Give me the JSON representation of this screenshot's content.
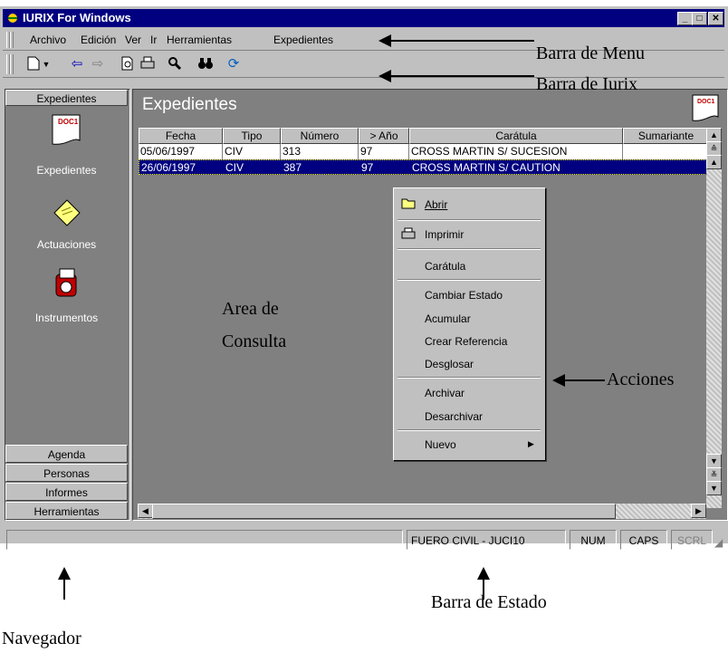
{
  "window": {
    "title": "IURIX For Windows",
    "min_label": "_",
    "max_label": "□",
    "close_label": "✕"
  },
  "menu": {
    "items": [
      "Archivo",
      "Edición",
      "Ver",
      "Ir",
      "Herramientas",
      "Expedientes"
    ]
  },
  "toolbar": {
    "icons": [
      "new-document-icon",
      "dropdown-icon",
      "back-icon",
      "forward-icon",
      "print-preview-icon",
      "print-icon",
      "search-icon",
      "binoculars-icon",
      "refresh-icon"
    ]
  },
  "navigator": {
    "header": "Expedientes",
    "items": [
      {
        "label": "Expedientes",
        "icon": "document-icon",
        "icon_text": "DOC1"
      },
      {
        "label": "Actuaciones",
        "icon": "notepad-icon"
      },
      {
        "label": "Instrumentos",
        "icon": "instruments-icon"
      }
    ],
    "bottom_buttons": [
      "Agenda",
      "Personas",
      "Informes",
      "Herramientas"
    ]
  },
  "main": {
    "title": "Expedientes",
    "doc_icon_text": "DOC1",
    "columns": [
      "Fecha",
      "Tipo",
      "Número",
      "> Año",
      "Carátula",
      "Sumariante"
    ],
    "rows": [
      {
        "fecha": "05/06/1997",
        "tipo": "CIV",
        "numero": "313",
        "anio": "97",
        "caratula": "CROSS MARTIN S/ SUCESION",
        "sumariante": ""
      },
      {
        "fecha": "26/06/1997",
        "tipo": "CIV",
        "numero": "387",
        "anio": "97",
        "caratula": "CROSS MARTIN S/ CAUTION",
        "sumariante": ""
      }
    ],
    "selected_row": 1
  },
  "context_menu": {
    "items": [
      "Abrir",
      "Imprimir",
      "Carátula",
      "Cambiar Estado",
      "Acumular",
      "Crear Referencia",
      "Desglosar",
      "Archivar",
      "Desarchivar",
      "Nuevo"
    ],
    "submenu_arrow": "▶"
  },
  "status_bar": {
    "court": "FUERO CIVIL - JUCI10",
    "num": "NUM",
    "caps": "CAPS",
    "scrl": "SCRL"
  },
  "annotations": {
    "menu_bar": "Barra de Menu",
    "iurix_bar": "Barra de Iurix",
    "query_area_line1": "Area de",
    "query_area_line2": "Consulta",
    "actions": "Acciones",
    "status_bar": "Barra de Estado",
    "navigator": "Navegador"
  },
  "colors": {
    "title_bar": "#000080",
    "selection": "#000080",
    "panel": "#808080",
    "face": "#c0c0c0"
  }
}
